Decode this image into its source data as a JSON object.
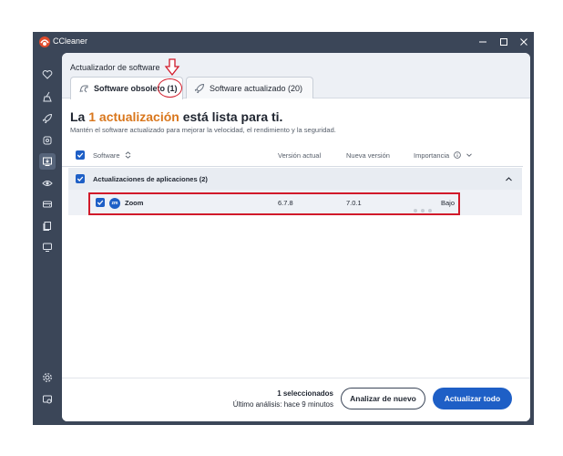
{
  "app": {
    "title": "CCleaner"
  },
  "window_controls": {
    "minimize": "minimize-icon",
    "maximize": "maximize-icon",
    "close": "close-icon"
  },
  "sidebar": {
    "items": [
      {
        "icon": "heart-icon"
      },
      {
        "icon": "broom-icon"
      },
      {
        "icon": "rocket-icon"
      },
      {
        "icon": "shield-icon"
      },
      {
        "icon": "software-update-icon",
        "active": true
      },
      {
        "icon": "privacy-eye-icon"
      },
      {
        "icon": "drive-icon"
      },
      {
        "icon": "documents-icon"
      },
      {
        "icon": "monitor-icon"
      }
    ],
    "bottom_items": [
      {
        "icon": "gear-icon"
      },
      {
        "icon": "account-icon"
      }
    ]
  },
  "section": {
    "title": "Actualizador de software",
    "tabs": [
      {
        "label": "Software obsoleto (1)",
        "active": true,
        "icon": "dinosaur-icon"
      },
      {
        "label": "Software actualizado (20)",
        "active": false,
        "icon": "rocket-icon"
      }
    ]
  },
  "headline": {
    "prefix": "La ",
    "accent": "1 actualización",
    "suffix": " está lista para ti."
  },
  "subtext": "Mantén el software actualizado para mejorar la velocidad, el rendimiento y la seguridad.",
  "table": {
    "columns": {
      "software": "Software",
      "current_version": "Versión actual",
      "new_version": "Nueva versión",
      "importance": "Importancia"
    },
    "group": {
      "label": "Actualizaciones de aplicaciones (2)",
      "checked": true
    },
    "rows": [
      {
        "name": "Zoom",
        "badge": "zm",
        "current_version": "6.7.8",
        "new_version": "7.0.1",
        "importance": "Bajo",
        "importance_level": 0,
        "checked": true
      }
    ]
  },
  "footer": {
    "selected": "1 seleccionados",
    "last_scan": "Último análisis: hace 9 minutos",
    "analyze_label": "Analizar de nuevo",
    "update_all_label": "Actualizar todo"
  },
  "colors": {
    "accent": "#d9771d",
    "primary": "#1e5fc6",
    "sidebar": "#3b4658",
    "annotation": "#d11a2a"
  }
}
